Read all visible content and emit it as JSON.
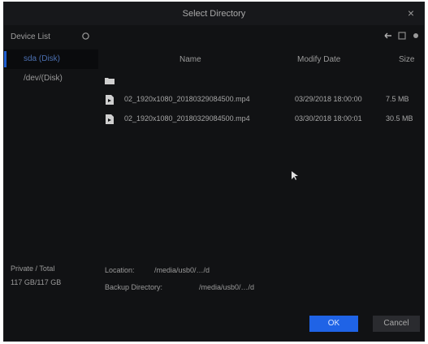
{
  "dialog": {
    "title": "Select Directory",
    "close_label": "×"
  },
  "sidebar": {
    "header": "Device List",
    "items": [
      {
        "label": "sda (Disk)"
      },
      {
        "label": "/dev/(Disk)"
      }
    ],
    "status_lines": [
      "Private / Total",
      "117 GB/117 GB"
    ]
  },
  "toolbar": {
    "icons": [
      "back-icon",
      "grid-icon",
      "settings-icon"
    ]
  },
  "table": {
    "columns": {
      "name": "Name",
      "date": "Modify Date",
      "size": "Size"
    },
    "rows": [
      {
        "type": "folder",
        "name": "",
        "date": "",
        "size": ""
      },
      {
        "type": "file",
        "name": "02_1920x1080_20180329084500.mp4",
        "date": "03/29/2018 18:00:00",
        "size": "7.5 MB"
      },
      {
        "type": "file",
        "name": "02_1920x1080_20180329084500.mp4",
        "date": "03/30/2018 18:00:01",
        "size": "30.5 MB"
      }
    ]
  },
  "location": {
    "label": "Location:",
    "value": "/media/usb0/…/d",
    "backup_label": "Backup Directory:",
    "backup_value": "/media/usb0/…/d"
  },
  "buttons": {
    "ok": "OK",
    "cancel": "Cancel"
  },
  "colors": {
    "accent": "#1f63e6",
    "background": "#111214"
  }
}
